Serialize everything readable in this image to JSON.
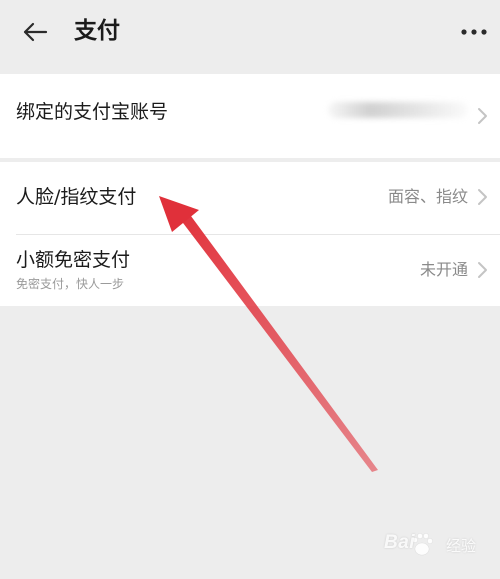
{
  "header": {
    "title": "支付",
    "back_icon": "arrow-left-icon",
    "more_icon": "more-horizontal-icon"
  },
  "alipay_row": {
    "label": "绑定的支付宝账号",
    "value_state": "blurred"
  },
  "face_row": {
    "label": "人脸/指纹支付",
    "value": "面容、指纹"
  },
  "smallpay_row": {
    "label": "小额免密支付",
    "sub": "免密支付，快人一步",
    "value": "未开通"
  },
  "colors": {
    "background": "#ededed",
    "card": "#ffffff",
    "annotation_arrow": "#e0303a"
  },
  "watermark": {
    "brand": "Bai",
    "suffix": "经验"
  }
}
